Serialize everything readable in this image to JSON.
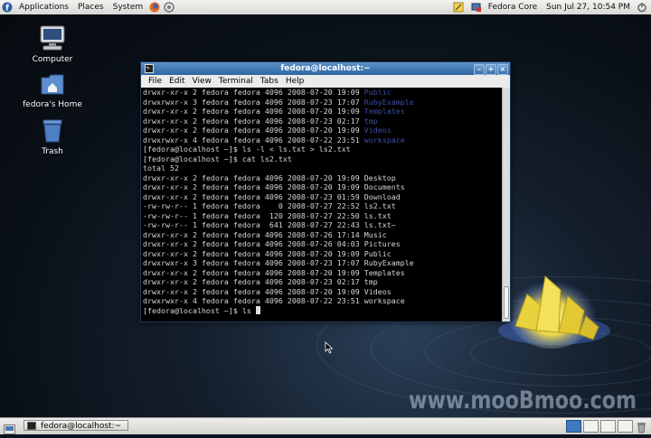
{
  "topbar": {
    "menus": [
      "Applications",
      "Places",
      "System"
    ],
    "network_label": "Fedora Core",
    "clock": "Sun Jul 27, 10:54 PM"
  },
  "desktop": {
    "icons": [
      {
        "label": "Computer",
        "icon": "computer-icon"
      },
      {
        "label": "fedora's Home",
        "icon": "home-folder-icon"
      },
      {
        "label": "Trash",
        "icon": "trash-icon"
      }
    ],
    "watermark": "www.mooBmoo.com"
  },
  "terminal": {
    "title": "fedora@localhost:~",
    "menu": [
      "File",
      "Edit",
      "View",
      "Terminal",
      "Tabs",
      "Help"
    ],
    "lines": [
      {
        "text": "drwxr-xr-x 2 fedora fedora 4096 2008-07-20 19:09 ",
        "dir": "Public"
      },
      {
        "text": "drwxrwxr-x 3 fedora fedora 4096 2008-07-23 17:07 ",
        "dir": "RubyExample"
      },
      {
        "text": "drwxr-xr-x 2 fedora fedora 4096 2008-07-20 19:09 ",
        "dir": "Templates"
      },
      {
        "text": "drwxr-xr-x 2 fedora fedora 4096 2008-07-23 02:17 ",
        "dir": "tmp"
      },
      {
        "text": "drwxr-xr-x 2 fedora fedora 4096 2008-07-20 19:09 ",
        "dir": "Videos"
      },
      {
        "text": "drwxrwxr-x 4 fedora fedora 4096 2008-07-22 23:51 ",
        "dir": "workspace"
      },
      {
        "text": "[fedora@localhost ~]$ ls -l < ls.txt > ls2.txt",
        "dir": ""
      },
      {
        "text": "[fedora@localhost ~]$ cat ls2.txt",
        "dir": ""
      },
      {
        "text": "total 52",
        "dir": ""
      },
      {
        "text": "drwxr-xr-x 2 fedora fedora 4096 2008-07-20 19:09 Desktop",
        "dir": ""
      },
      {
        "text": "drwxr-xr-x 2 fedora fedora 4096 2008-07-20 19:09 Documents",
        "dir": ""
      },
      {
        "text": "drwxr-xr-x 2 fedora fedora 4096 2008-07-23 01:59 Download",
        "dir": ""
      },
      {
        "text": "-rw-rw-r-- 1 fedora fedora    0 2008-07-27 22:52 ls2.txt",
        "dir": ""
      },
      {
        "text": "-rw-rw-r-- 1 fedora fedora  120 2008-07-27 22:50 ls.txt",
        "dir": ""
      },
      {
        "text": "-rw-rw-r-- 1 fedora fedora  641 2008-07-27 22:43 ls.txt~",
        "dir": ""
      },
      {
        "text": "drwxr-xr-x 2 fedora fedora 4096 2008-07-26 17:14 Music",
        "dir": ""
      },
      {
        "text": "drwxr-xr-x 2 fedora fedora 4096 2008-07-26 04:03 Pictures",
        "dir": ""
      },
      {
        "text": "drwxr-xr-x 2 fedora fedora 4096 2008-07-20 19:09 Public",
        "dir": ""
      },
      {
        "text": "drwxrwxr-x 3 fedora fedora 4096 2008-07-23 17:07 RubyExample",
        "dir": ""
      },
      {
        "text": "drwxr-xr-x 2 fedora fedora 4096 2008-07-20 19:09 Templates",
        "dir": ""
      },
      {
        "text": "drwxr-xr-x 2 fedora fedora 4096 2008-07-23 02:17 tmp",
        "dir": ""
      },
      {
        "text": "drwxr-xr-x 2 fedora fedora 4096 2008-07-20 19:09 Videos",
        "dir": ""
      },
      {
        "text": "drwxrwxr-x 4 fedora fedora 4096 2008-07-22 23:51 workspace",
        "dir": ""
      }
    ],
    "prompt": "[fedora@localhost ~]$ ls "
  },
  "taskbar": {
    "window_button": "fedora@localhost:~"
  },
  "colors": {
    "dir_listing": "#3a4fa8",
    "title_bar": "#2f65a1"
  }
}
